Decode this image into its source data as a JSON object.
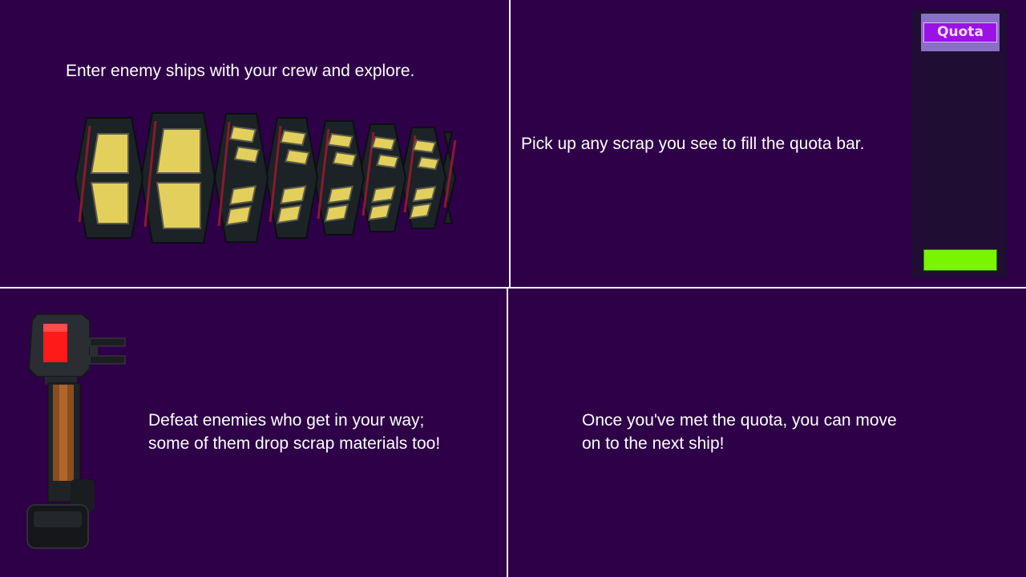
{
  "panels": {
    "top_left": {
      "caption": "Enter enemy ships with your crew and explore."
    },
    "top_right": {
      "caption": "Pick up any scrap you see to fill the quota bar."
    },
    "bottom_left": {
      "caption_line1": "Defeat enemies who get in your way;",
      "caption_line2": "some of them drop scrap materials too!"
    },
    "bottom_right": {
      "caption_line1": "Once you've met the quota, you can move",
      "caption_line2": "on to the next ship!"
    }
  },
  "quota_bar": {
    "label": "Quota",
    "fill_fraction": 0.1
  },
  "colors": {
    "background": "#2e0048",
    "divider": "#ffffff",
    "quota_fill": "#79f500",
    "ship_window": "#e3cf5c",
    "robot_light": "#ff1a1a"
  },
  "icons": {
    "ship": "enemy-ship-icon",
    "robot": "enemy-robot-icon"
  }
}
